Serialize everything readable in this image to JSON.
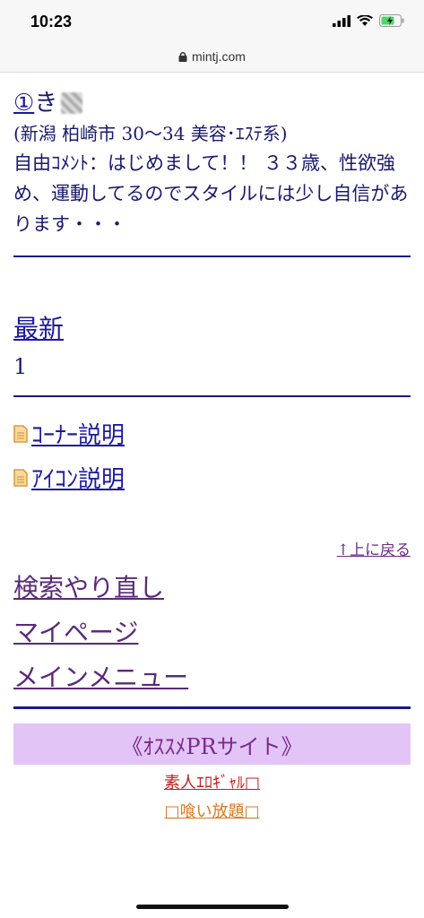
{
  "status": {
    "time": "10:23"
  },
  "browser": {
    "url": "mintj.com"
  },
  "profile": {
    "number": "①",
    "name": "き",
    "info": "(新潟 柏崎市 30〜34 美容･ｴｽﾃ系)",
    "comment": "自由ｺﾒﾝﾄ：はじめまして！！ ３３歳、性欲強め、運動してるのでスタイルには少し自信があります・・・"
  },
  "latest": {
    "label": "最新",
    "count": "1"
  },
  "help": [
    {
      "label": "ｺｰﾅｰ説明",
      "icon": "document-icon"
    },
    {
      "label": "ｱｲｺﾝ説明",
      "icon": "document-icon"
    }
  ],
  "back_to_top": "↑上に戻る",
  "nav": {
    "search_again": "検索やり直し",
    "my_page": "マイページ",
    "main_menu": "メインメニュー"
  },
  "pr": {
    "title": "《ｵｽｽﾒPRサイト》",
    "link1": "素人ｴﾛｷﾞｬﾙ□",
    "link2": "□喰い放題□"
  },
  "colors": {
    "accent": "#1a1a9e",
    "pr_bg": "#e3c4f7",
    "divider": "#1a1a7e"
  }
}
